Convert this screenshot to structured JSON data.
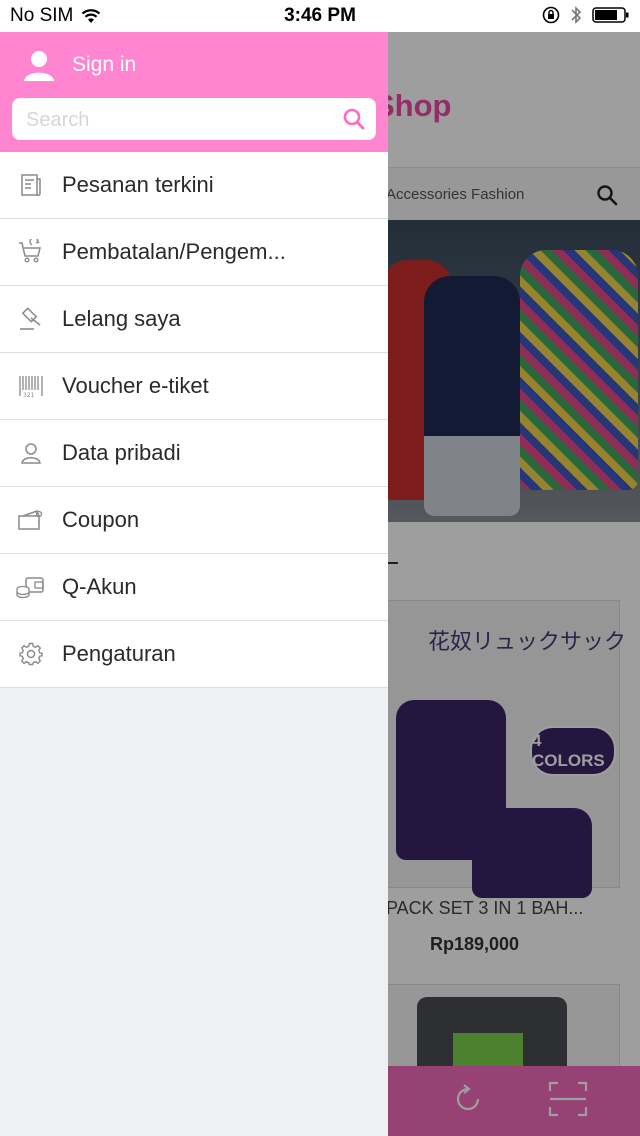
{
  "status_bar": {
    "carrier": "No SIM",
    "time": "3:46 PM"
  },
  "background_page": {
    "shop_title": "Shop",
    "category_tab": "Accessories Fashion",
    "section_mark": "-",
    "product": {
      "image_text_jp": "花奴リュックサック",
      "colors_badge": "4 COLORS",
      "name": "PACK SET 3 IN 1 BAH...",
      "price": "Rp189,000"
    }
  },
  "drawer": {
    "signin_label": "Sign in",
    "search_placeholder": "Search",
    "menu": [
      {
        "label": "Pesanan terkini",
        "icon": "receipt-icon"
      },
      {
        "label": "Pembatalan/Pengem...",
        "icon": "cart-return-icon"
      },
      {
        "label": "Lelang saya",
        "icon": "auction-gavel-icon"
      },
      {
        "label": "Voucher e-tiket",
        "icon": "barcode-icon"
      },
      {
        "label": "Data pribadi",
        "icon": "person-icon"
      },
      {
        "label": "Coupon",
        "icon": "coupon-icon"
      },
      {
        "label": "Q-Akun",
        "icon": "wallet-coins-icon"
      },
      {
        "label": "Pengaturan",
        "icon": "gear-icon"
      }
    ]
  },
  "colors": {
    "drawer_header": "#ff85d0",
    "accent": "#ec4aa8",
    "bottom_bar": "#f46bbd"
  }
}
